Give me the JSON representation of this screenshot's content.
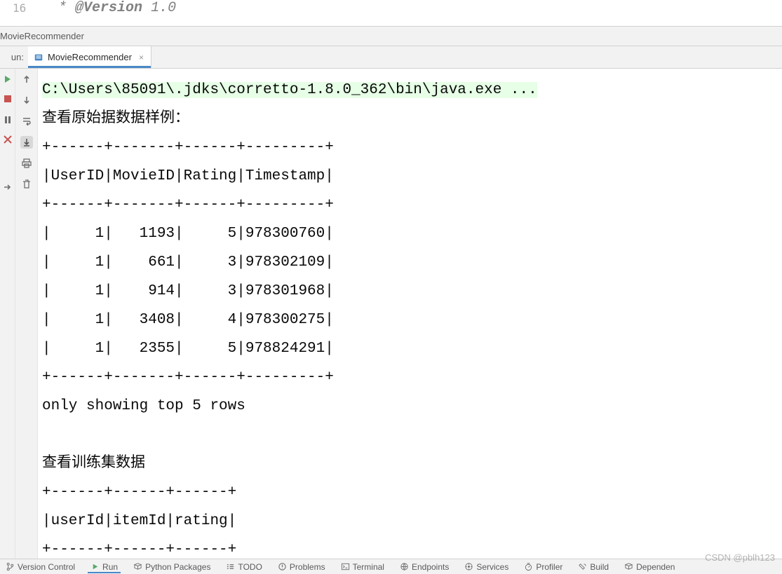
{
  "editor": {
    "line_number": "16",
    "doc_star": "*",
    "doc_tag": "@Version",
    "doc_ver": "1.0"
  },
  "breadcrumb": {
    "text": "MovieRecommender"
  },
  "run": {
    "label": "un:",
    "tab_name": "MovieRecommender"
  },
  "console": {
    "cmd": "C:\\Users\\85091\\.jdks\\corretto-1.8.0_362\\bin\\java.exe ...",
    "line2": "查看原始据数据样例：",
    "sep1": "+------+-------+------+---------+",
    "hdr1": "|UserID|MovieID|Rating|Timestamp|",
    "sep2": "+------+-------+------+---------+",
    "r1": "|     1|   1193|     5|978300760|",
    "r2": "|     1|    661|     3|978302109|",
    "r3": "|     1|    914|     3|978301968|",
    "r4": "|     1|   3408|     4|978300275|",
    "r5": "|     1|   2355|     5|978824291|",
    "sep3": "+------+-------+------+---------+",
    "only": "only showing top 5 rows",
    "blank": "",
    "line13": "查看训练集数据",
    "sep4": "+------+------+------+",
    "hdr2": "|userId|itemId|rating|",
    "sep5_partial": "+------+------+------+"
  },
  "chart_data": [
    {
      "type": "table",
      "title": "查看原始据数据样例：",
      "columns": [
        "UserID",
        "MovieID",
        "Rating",
        "Timestamp"
      ],
      "rows": [
        [
          1,
          1193,
          5,
          978300760
        ],
        [
          1,
          661,
          3,
          978302109
        ],
        [
          1,
          914,
          3,
          978301968
        ],
        [
          1,
          3408,
          4,
          978300275
        ],
        [
          1,
          2355,
          5,
          978824291
        ]
      ],
      "note": "only showing top 5 rows"
    },
    {
      "type": "table",
      "title": "查看训练集数据",
      "columns": [
        "userId",
        "itemId",
        "rating"
      ],
      "rows": []
    }
  ],
  "bottom": {
    "version_control": "Version Control",
    "run": "Run",
    "python_packages": "Python Packages",
    "todo": "TODO",
    "problems": "Problems",
    "terminal": "Terminal",
    "endpoints": "Endpoints",
    "services": "Services",
    "profiler": "Profiler",
    "build": "Build",
    "dependencies": "Dependen"
  },
  "watermark": "CSDN @pblh123",
  "icons": {
    "play": "▶",
    "rerun": "↻",
    "stop": "■",
    "down": "↓",
    "up": "↑",
    "wrap": "⤶",
    "print": "🖶",
    "trash": "🗑",
    "scroll": "↧",
    "step": "→"
  }
}
